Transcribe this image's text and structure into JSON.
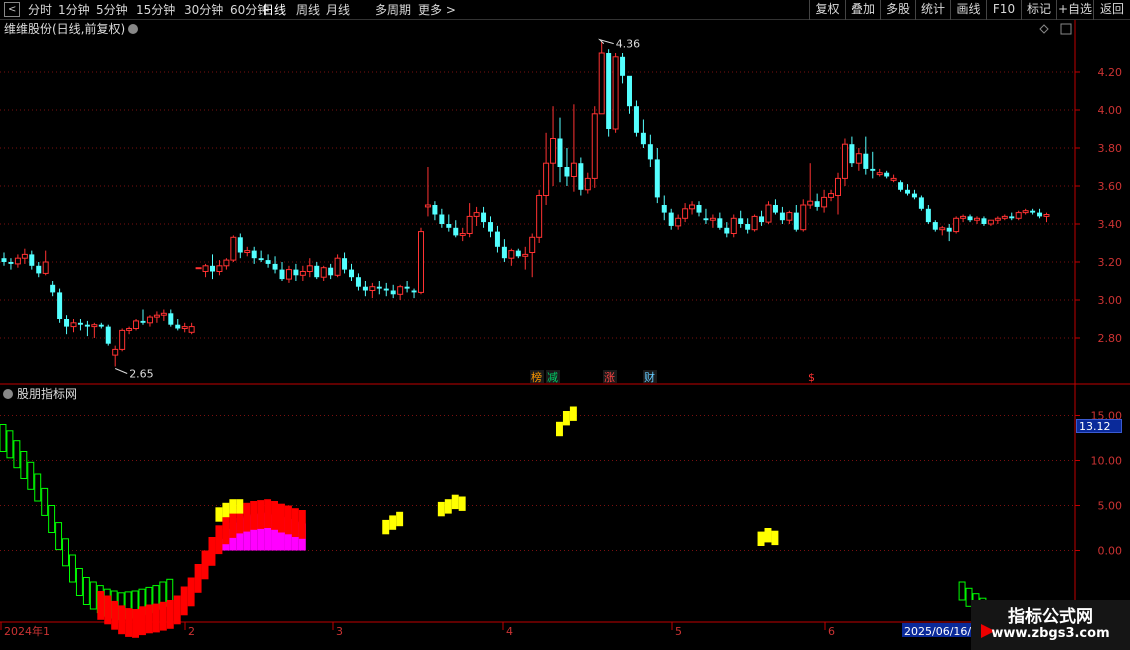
{
  "toolbar": {
    "left": [
      "分时",
      "1分钟",
      "5分钟",
      "15分钟",
      "30分钟",
      "60分钟",
      "日线",
      "周线",
      "月线",
      "多周期",
      "更多 >"
    ],
    "active": "日线",
    "right": [
      "复权",
      "叠加",
      "多股",
      "统计",
      "画线",
      "F10",
      "标记",
      "+自选",
      "返回"
    ]
  },
  "upper": {
    "title": "维维股份(日线,前复权)",
    "high_label": "4.36",
    "low_label": "2.65",
    "y_ticks": [
      "4.20",
      "4.00",
      "3.80",
      "3.60",
      "3.40",
      "3.20",
      "3.00",
      "2.80"
    ],
    "events": [
      {
        "text": "榜",
        "color": "#ff9900"
      },
      {
        "text": "减",
        "color": "#00cc66"
      },
      {
        "text": "涨",
        "color": "#ff4444"
      },
      {
        "text": "财",
        "color": "#66ccff"
      },
      {
        "text": "$",
        "color": "#ff3333"
      }
    ]
  },
  "lower": {
    "title": "股朋指标网",
    "y_ticks": [
      "15.00",
      "10.00",
      "5.00",
      "0.00"
    ],
    "current_value": "13.12"
  },
  "x_axis": {
    "labels": [
      "2024年1",
      "2",
      "3",
      "4",
      "5",
      "6"
    ],
    "end_label": "2025/06/16/"
  },
  "watermark": {
    "title": "指标公式网",
    "url": "www.zbgs3.com"
  },
  "colors": {
    "up": "#ff3232",
    "down": "#54ffff",
    "grid": "#7a1010",
    "axis": "#c00000",
    "tick_text": "#cc3333",
    "magenta": "#ff00ff",
    "yellow": "#ffff00",
    "red": "#ff0000",
    "green": "#00ff00"
  },
  "chart_data": {
    "type": "candlestick",
    "price_candles": [
      [
        3.22,
        3.25,
        3.18,
        3.2
      ],
      [
        3.2,
        3.22,
        3.16,
        3.19
      ],
      [
        3.19,
        3.24,
        3.17,
        3.22
      ],
      [
        3.22,
        3.27,
        3.19,
        3.24
      ],
      [
        3.24,
        3.26,
        3.16,
        3.18
      ],
      [
        3.18,
        3.2,
        3.12,
        3.14
      ],
      [
        3.14,
        3.26,
        3.13,
        3.2
      ],
      [
        3.08,
        3.1,
        3.02,
        3.04
      ],
      [
        3.04,
        3.06,
        2.88,
        2.9
      ],
      [
        2.9,
        2.92,
        2.82,
        2.86
      ],
      [
        2.86,
        2.9,
        2.83,
        2.88
      ],
      [
        2.88,
        2.9,
        2.84,
        2.87
      ],
      [
        2.87,
        2.89,
        2.81,
        2.86
      ],
      [
        2.86,
        2.88,
        2.8,
        2.87
      ],
      [
        2.87,
        2.88,
        2.85,
        2.86
      ],
      [
        2.86,
        2.87,
        2.76,
        2.77
      ],
      [
        2.71,
        2.76,
        2.65,
        2.74
      ],
      [
        2.74,
        2.85,
        2.73,
        2.84
      ],
      [
        2.84,
        2.86,
        2.82,
        2.85
      ],
      [
        2.85,
        2.9,
        2.84,
        2.89
      ],
      [
        2.89,
        2.95,
        2.87,
        2.88
      ],
      [
        2.88,
        2.92,
        2.86,
        2.91
      ],
      [
        2.91,
        2.94,
        2.88,
        2.92
      ],
      [
        2.92,
        2.95,
        2.89,
        2.93
      ],
      [
        2.93,
        2.95,
        2.86,
        2.87
      ],
      [
        2.87,
        2.9,
        2.84,
        2.85
      ],
      [
        2.85,
        2.88,
        2.83,
        2.86
      ],
      [
        2.83,
        2.88,
        2.82,
        2.86
      ],
      [
        3.17,
        3.17,
        3.17,
        3.17
      ],
      [
        3.15,
        3.19,
        3.12,
        3.18
      ],
      [
        3.18,
        3.24,
        3.11,
        3.15
      ],
      [
        3.15,
        3.21,
        3.13,
        3.18
      ],
      [
        3.18,
        3.22,
        3.16,
        3.21
      ],
      [
        3.21,
        3.34,
        3.2,
        3.33
      ],
      [
        3.33,
        3.35,
        3.22,
        3.25
      ],
      [
        3.25,
        3.28,
        3.23,
        3.26
      ],
      [
        3.26,
        3.28,
        3.19,
        3.22
      ],
      [
        3.22,
        3.26,
        3.2,
        3.21
      ],
      [
        3.21,
        3.24,
        3.17,
        3.19
      ],
      [
        3.19,
        3.23,
        3.14,
        3.16
      ],
      [
        3.16,
        3.2,
        3.1,
        3.11
      ],
      [
        3.11,
        3.18,
        3.09,
        3.16
      ],
      [
        3.16,
        3.19,
        3.1,
        3.13
      ],
      [
        3.13,
        3.18,
        3.1,
        3.15
      ],
      [
        3.15,
        3.22,
        3.12,
        3.18
      ],
      [
        3.18,
        3.2,
        3.11,
        3.12
      ],
      [
        3.12,
        3.18,
        3.1,
        3.17
      ],
      [
        3.17,
        3.19,
        3.11,
        3.13
      ],
      [
        3.13,
        3.24,
        3.12,
        3.22
      ],
      [
        3.22,
        3.25,
        3.14,
        3.16
      ],
      [
        3.16,
        3.19,
        3.1,
        3.12
      ],
      [
        3.12,
        3.14,
        3.05,
        3.07
      ],
      [
        3.07,
        3.1,
        3.02,
        3.05
      ],
      [
        3.05,
        3.09,
        3.01,
        3.07
      ],
      [
        3.07,
        3.1,
        3.03,
        3.06
      ],
      [
        3.06,
        3.09,
        3.02,
        3.05
      ],
      [
        3.05,
        3.08,
        3.01,
        3.03
      ],
      [
        3.03,
        3.08,
        3.0,
        3.07
      ],
      [
        3.07,
        3.1,
        3.04,
        3.06
      ],
      [
        3.05,
        3.06,
        3.01,
        3.04
      ],
      [
        3.04,
        3.38,
        3.03,
        3.36
      ],
      [
        3.49,
        3.7,
        3.44,
        3.5
      ],
      [
        3.5,
        3.52,
        3.42,
        3.45
      ],
      [
        3.45,
        3.48,
        3.38,
        3.4
      ],
      [
        3.4,
        3.45,
        3.36,
        3.38
      ],
      [
        3.38,
        3.42,
        3.33,
        3.34
      ],
      [
        3.34,
        3.38,
        3.31,
        3.35
      ],
      [
        3.35,
        3.51,
        3.33,
        3.44
      ],
      [
        3.44,
        3.49,
        3.39,
        3.46
      ],
      [
        3.46,
        3.49,
        3.38,
        3.41
      ],
      [
        3.41,
        3.44,
        3.33,
        3.36
      ],
      [
        3.36,
        3.39,
        3.25,
        3.28
      ],
      [
        3.28,
        3.32,
        3.2,
        3.22
      ],
      [
        3.22,
        3.27,
        3.18,
        3.26
      ],
      [
        3.26,
        3.27,
        3.22,
        3.23
      ],
      [
        3.23,
        3.28,
        3.16,
        3.24
      ],
      [
        3.25,
        3.35,
        3.12,
        3.33
      ],
      [
        3.33,
        3.58,
        3.3,
        3.55
      ],
      [
        3.55,
        3.88,
        3.5,
        3.72
      ],
      [
        3.72,
        4.02,
        3.6,
        3.85
      ],
      [
        3.85,
        3.96,
        3.62,
        3.7
      ],
      [
        3.7,
        3.8,
        3.6,
        3.65
      ],
      [
        3.65,
        4.03,
        3.57,
        3.72
      ],
      [
        3.72,
        3.75,
        3.55,
        3.58
      ],
      [
        3.58,
        3.67,
        3.56,
        3.64
      ],
      [
        3.64,
        4.02,
        3.59,
        3.98
      ],
      [
        3.98,
        4.36,
        3.98,
        4.3
      ],
      [
        4.3,
        4.32,
        3.86,
        3.9
      ],
      [
        3.9,
        4.3,
        3.88,
        4.28
      ],
      [
        4.28,
        4.3,
        4.14,
        4.18
      ],
      [
        4.18,
        4.12,
        3.98,
        4.02
      ],
      [
        4.02,
        4.05,
        3.86,
        3.88
      ],
      [
        3.88,
        3.95,
        3.8,
        3.82
      ],
      [
        3.82,
        3.87,
        3.7,
        3.74
      ],
      [
        3.74,
        3.8,
        3.51,
        3.54
      ],
      [
        3.5,
        3.55,
        3.42,
        3.46
      ],
      [
        3.46,
        3.48,
        3.37,
        3.39
      ],
      [
        3.39,
        3.45,
        3.37,
        3.43
      ],
      [
        3.43,
        3.51,
        3.41,
        3.48
      ],
      [
        3.48,
        3.52,
        3.45,
        3.5
      ],
      [
        3.5,
        3.52,
        3.44,
        3.46
      ],
      [
        3.43,
        3.48,
        3.4,
        3.42
      ],
      [
        3.42,
        3.45,
        3.38,
        3.43
      ],
      [
        3.43,
        3.46,
        3.37,
        3.38
      ],
      [
        3.38,
        3.41,
        3.33,
        3.35
      ],
      [
        3.35,
        3.45,
        3.33,
        3.43
      ],
      [
        3.43,
        3.47,
        3.38,
        3.4
      ],
      [
        3.4,
        3.43,
        3.35,
        3.37
      ],
      [
        3.37,
        3.45,
        3.36,
        3.44
      ],
      [
        3.44,
        3.47,
        3.39,
        3.41
      ],
      [
        3.41,
        3.52,
        3.4,
        3.5
      ],
      [
        3.5,
        3.53,
        3.45,
        3.46
      ],
      [
        3.46,
        3.49,
        3.4,
        3.42
      ],
      [
        3.42,
        3.47,
        3.4,
        3.46
      ],
      [
        3.46,
        3.5,
        3.36,
        3.37
      ],
      [
        3.37,
        3.53,
        3.36,
        3.5
      ],
      [
        3.5,
        3.72,
        3.48,
        3.52
      ],
      [
        3.52,
        3.56,
        3.47,
        3.49
      ],
      [
        3.49,
        3.58,
        3.46,
        3.54
      ],
      [
        3.54,
        3.58,
        3.52,
        3.56
      ],
      [
        3.55,
        3.67,
        3.45,
        3.64
      ],
      [
        3.64,
        3.85,
        3.6,
        3.82
      ],
      [
        3.82,
        3.86,
        3.7,
        3.72
      ],
      [
        3.72,
        3.8,
        3.68,
        3.77
      ],
      [
        3.77,
        3.86,
        3.66,
        3.69
      ],
      [
        3.69,
        3.78,
        3.64,
        3.68
      ],
      [
        3.66,
        3.69,
        3.65,
        3.67
      ],
      [
        3.67,
        3.68,
        3.64,
        3.65
      ],
      [
        3.63,
        3.66,
        3.62,
        3.64
      ],
      [
        3.62,
        3.63,
        3.57,
        3.58
      ],
      [
        3.58,
        3.61,
        3.55,
        3.56
      ],
      [
        3.56,
        3.58,
        3.53,
        3.54
      ],
      [
        3.54,
        3.55,
        3.47,
        3.48
      ],
      [
        3.48,
        3.5,
        3.4,
        3.41
      ],
      [
        3.41,
        3.42,
        3.36,
        3.37
      ],
      [
        3.37,
        3.39,
        3.34,
        3.38
      ],
      [
        3.38,
        3.4,
        3.31,
        3.36
      ],
      [
        3.36,
        3.44,
        3.35,
        3.43
      ],
      [
        3.43,
        3.45,
        3.41,
        3.44
      ],
      [
        3.44,
        3.45,
        3.41,
        3.42
      ],
      [
        3.42,
        3.44,
        3.4,
        3.43
      ],
      [
        3.43,
        3.44,
        3.39,
        3.4
      ],
      [
        3.4,
        3.42,
        3.39,
        3.42
      ],
      [
        3.42,
        3.44,
        3.4,
        3.43
      ],
      [
        3.43,
        3.45,
        3.42,
        3.44
      ],
      [
        3.44,
        3.46,
        3.42,
        3.43
      ],
      [
        3.43,
        3.47,
        3.42,
        3.46
      ],
      [
        3.46,
        3.48,
        3.45,
        3.47
      ],
      [
        3.47,
        3.48,
        3.45,
        3.46
      ],
      [
        3.46,
        3.48,
        3.43,
        3.44
      ],
      [
        3.44,
        3.46,
        3.41,
        3.45
      ]
    ],
    "indicator": {
      "range": [
        -4,
        16.5
      ],
      "outline_green": [
        12.5,
        11.8,
        10.7,
        9.5,
        8.3,
        7,
        5.4,
        3.5,
        1.6,
        -0.2,
        -2,
        -3.5,
        -4.5,
        -5,
        -5.4,
        -5.8,
        -6,
        -6.2,
        -6.1,
        -6,
        -5.8,
        -5.6,
        -5.4,
        -5,
        -4.7
      ],
      "red_band": {
        "start": 14,
        "values": [
          -4.5,
          -5,
          -5.6,
          -6.1,
          -6.4,
          -6.5,
          -6.2,
          -6.0,
          -5.9,
          -5.7,
          -5.5,
          -5.0,
          -4.0,
          -3.0,
          -1.5,
          0,
          1.5,
          2.8,
          3.9,
          4.6,
          5.1,
          5.3,
          5.5,
          5.6,
          5.7,
          5.5,
          5.2,
          5.0,
          4.7,
          4.5
        ]
      },
      "magenta_blocks": [
        {
          "start": 22,
          "values": [
            0,
            -1,
            -2,
            -3,
            -4,
            -5,
            -5.5,
            -5.7,
            0,
            0,
            0,
            0,
            0,
            0,
            0,
            0,
            0,
            0,
            0,
            0,
            0,
            0,
            0,
            0,
            0,
            0,
            0,
            0
          ]
        },
        {
          "start": 52,
          "values": [
            0,
            0,
            0,
            0,
            0,
            0,
            0,
            0,
            0,
            0,
            0,
            0,
            0,
            0,
            0
          ]
        },
        {
          "start": 69,
          "values": [
            0,
            0,
            0,
            0,
            0,
            0,
            0,
            0,
            0,
            0,
            0,
            0,
            0,
            0,
            0,
            0,
            0,
            0
          ]
        },
        {
          "start": 99,
          "values": [
            0,
            0,
            0,
            0,
            0,
            0,
            0,
            0,
            0,
            0,
            0,
            0,
            0,
            0,
            0,
            0,
            0
          ]
        },
        {
          "start": 129,
          "values": [
            0,
            0,
            0,
            0,
            0,
            0,
            0,
            0,
            0,
            0,
            0,
            0,
            0,
            0,
            0
          ]
        }
      ],
      "yellow_blocks": [
        {
          "start": 31,
          "values": [
            4.8,
            5.3,
            5.7,
            5.7
          ]
        },
        {
          "start": 55,
          "values": [
            3.4,
            3.9,
            4.3
          ]
        },
        {
          "start": 63,
          "values": [
            5.4,
            5.7,
            6.2,
            6.0
          ]
        },
        {
          "start": 80,
          "values": [
            14.3,
            15.5,
            16.0
          ]
        },
        {
          "start": 109,
          "values": [
            2.1,
            2.5,
            2.2
          ]
        }
      ],
      "tail": [
        -4.5,
        -5.2,
        -5.8,
        -6.3,
        -6.7,
        -6.9,
        -7.2,
        -7.6,
        -7.9,
        -8.3,
        -8.6,
        -8.8,
        -8.9,
        -8.9
      ]
    }
  }
}
